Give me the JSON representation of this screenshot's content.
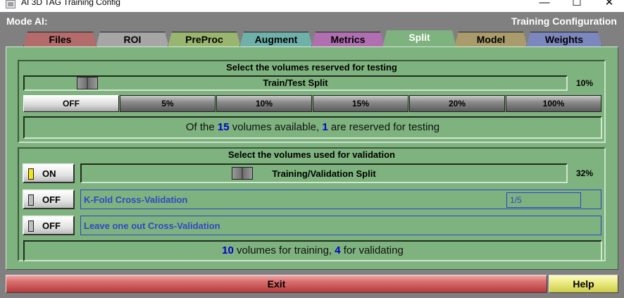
{
  "window": {
    "title": "AI 3D TAG Training Config",
    "minimize": "—",
    "maximize": "☐",
    "close": "✕"
  },
  "header": {
    "mode_label": "Mode AI:",
    "section_title": "Training Configuration"
  },
  "tabs": [
    {
      "label": "Files",
      "color": "#b36b6b"
    },
    {
      "label": "ROI",
      "color": "#a6a6a6"
    },
    {
      "label": "PreProc",
      "color": "#99b56f"
    },
    {
      "label": "Augment",
      "color": "#6fb0a9"
    },
    {
      "label": "Metrics",
      "color": "#b06fb0"
    },
    {
      "label": "Split",
      "color": "#7eb27e",
      "active": true
    },
    {
      "label": "Model",
      "color": "#a99b6b"
    },
    {
      "label": "Weights",
      "color": "#7b87bd"
    }
  ],
  "testing": {
    "title": "Select the volumes reserved for testing",
    "slider_label": "Train/Test Split",
    "percent": "10%",
    "options": [
      "OFF",
      "5%",
      "10%",
      "15%",
      "20%",
      "100%"
    ],
    "info_prefix": "Of the",
    "info_total": "15",
    "info_middle": "volumes available,",
    "info_reserved": "1",
    "info_suffix": "are reserved for testing"
  },
  "validation": {
    "title": "Select the volumes used for validation",
    "split_toggle": "ON",
    "split_led_color": "#f3e11a",
    "slider_label": "Training/Validation Split",
    "percent": "32%",
    "kfold_toggle": "OFF",
    "kfold_label": "K-Fold Cross-Validation",
    "kfold_value": "1/5",
    "loo_toggle": "OFF",
    "loo_label": "Leave one out Cross-Validation",
    "off_led_color": "#bdbdbd",
    "info_training": "10",
    "info_middle": "volumes for training,",
    "info_validating": "4",
    "info_suffix": "for validating"
  },
  "footer": {
    "exit_label": "Exit",
    "help_label": "Help"
  }
}
